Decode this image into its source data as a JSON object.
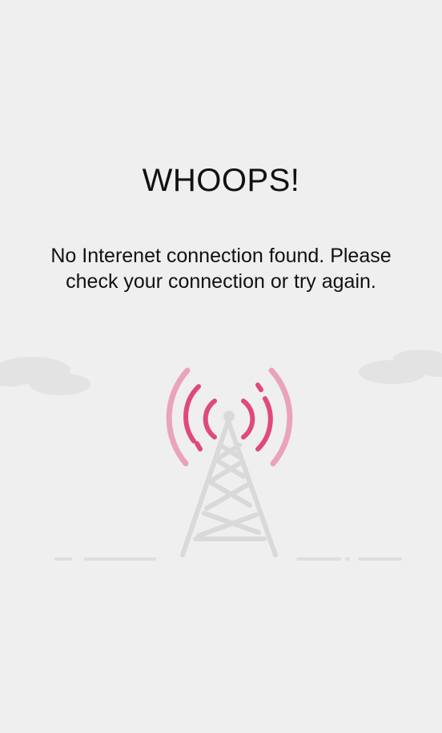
{
  "error": {
    "title": "WHOOPS!",
    "message": "No Interenet connection found. Please check your connection or try again."
  },
  "illustration": {
    "icon": "radio-tower-no-signal",
    "accent_color": "#e0497a",
    "accent_light_color": "#eaa3bb",
    "tower_color": "#d9d9d9",
    "cloud_color": "#e3e3e3",
    "ground_color": "#dedede"
  },
  "theme": {
    "background": "#efefef",
    "text_color": "#111111"
  }
}
